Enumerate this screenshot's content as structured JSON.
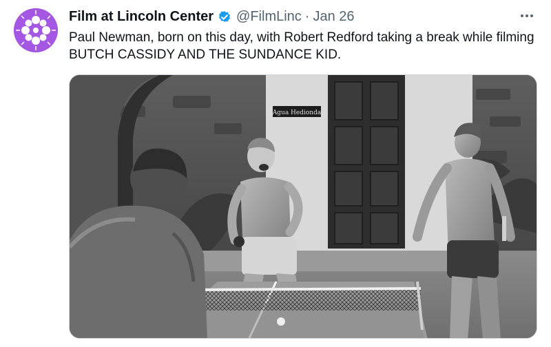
{
  "tweet": {
    "author": {
      "display_name": "Film at Lincoln Center",
      "handle": "@FilmLinc",
      "verified_icon": "verified-badge-icon"
    },
    "separator": "·",
    "date": "Jan 26",
    "more_icon": "more-horizontal-icon",
    "text": "Paul Newman, born on this day, with Robert Redford taking a break while filming BUTCH CASSIDY AND THE SUNDANCE KID.",
    "media": {
      "door_sign": "Agua Hedionda"
    }
  },
  "colors": {
    "avatar": "#a357e3",
    "verified": "#1d9bf0",
    "secondary_text": "#536471",
    "primary_text": "#0f1419"
  }
}
